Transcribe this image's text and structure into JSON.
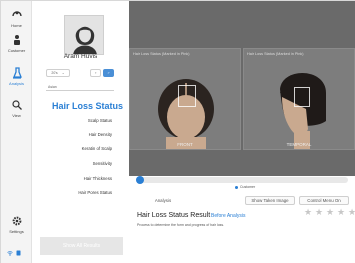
{
  "nav": {
    "items": [
      {
        "label": "Home",
        "icon": "home-icon"
      },
      {
        "label": "Customer",
        "icon": "customer-icon"
      },
      {
        "label": "Analysis",
        "icon": "analysis-icon"
      },
      {
        "label": "View",
        "icon": "view-icon"
      },
      {
        "label": "Settings",
        "icon": "settings-icon"
      }
    ],
    "active_color": "#2a7fd4"
  },
  "profile": {
    "name": "Aram Huvis",
    "age_select": "20's",
    "gender_buttons": [
      "♀",
      "♂"
    ],
    "region_select": "Asian"
  },
  "menu": {
    "title": "Hair Loss Status",
    "items": [
      "Scalp Status",
      "Hair Density",
      "Keratin of Scalp",
      "Sensitivity",
      "Hair Thickness",
      "Hair Pores Status"
    ],
    "show_all": "Show All Results"
  },
  "viewer": {
    "front": {
      "label": "Hair Loss Status (Marked in Pink)",
      "caption": "FRONT"
    },
    "temporal": {
      "label": "Hair Loss Status (Marked in Pink)",
      "caption": "TEMPORAL"
    }
  },
  "progress": {
    "value": 0.0,
    "legend": "Customer"
  },
  "controls": {
    "analysis": "Analysis",
    "show_taken": "Show Taken Image",
    "control_menu": "Control Menu On"
  },
  "result": {
    "title": "Hair Loss Status Result",
    "link": "Before Analysis",
    "description": "Process to determine the form and progress of hair loss.",
    "stars": 5
  }
}
